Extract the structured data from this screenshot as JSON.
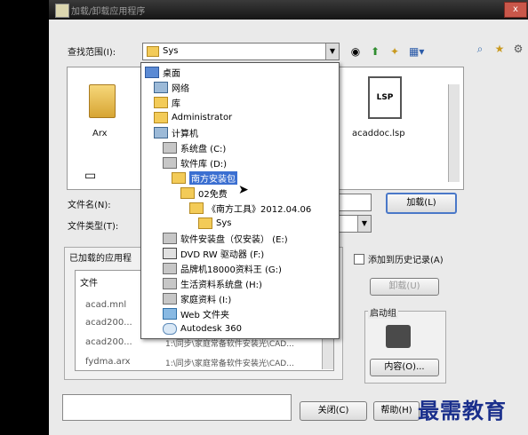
{
  "window": {
    "title": "加载/卸载应用程序",
    "close_label": "x"
  },
  "lookin": {
    "label": "查找范围(I):",
    "value": "Sys"
  },
  "files": [
    {
      "name": "Arx",
      "type": "folder"
    },
    {
      "name": "acaddoc.lsp",
      "type": "lsp",
      "badge": "LSP"
    }
  ],
  "form": {
    "filename_label": "文件名(N):",
    "filetype_label": "文件类型(T):",
    "load_button": "加载(L)"
  },
  "loaded": {
    "group_label": "已加载的应用程",
    "col_file": "文件",
    "rows": [
      "acad.mnl",
      "acad200...",
      "acad200...",
      "fydma.arx"
    ],
    "paths": [
      "",
      "",
      "1:\\同步\\家庭常备软件安装光\\CAD...",
      "1:\\同步\\家庭常备软件安装光\\CAD..."
    ]
  },
  "history": {
    "checkbox_label": "添加到历史记录(A)",
    "unload_button": "卸载(U)"
  },
  "startup": {
    "group_label": "启动组",
    "contents_button": "内容(O)..."
  },
  "footer": {
    "close_button": "关闭(C)",
    "help_button": "帮助(H)"
  },
  "dropdown": {
    "items": [
      {
        "label": "桌面",
        "icon": "desktop-icon"
      },
      {
        "label": "网络",
        "icon": "network-icon"
      },
      {
        "label": "库",
        "icon": "library-icon"
      },
      {
        "label": "Administrator",
        "icon": "user-folder-icon"
      },
      {
        "label": "计算机",
        "icon": "computer-icon"
      },
      {
        "label": "系统盘 (C:)",
        "icon": "drive-icon"
      },
      {
        "label": "软件库 (D:)",
        "icon": "drive-icon"
      },
      {
        "label": "南方安装包",
        "icon": "folder-icon"
      },
      {
        "label": "02免费",
        "icon": "folder-icon"
      },
      {
        "label": "《南方工具》2012.04.06",
        "icon": "folder-icon"
      },
      {
        "label": "Sys",
        "icon": "folder-icon"
      },
      {
        "label": "软件安装盘（仅安装） (E:)",
        "icon": "drive-icon"
      },
      {
        "label": "DVD RW 驱动器 (F:)",
        "icon": "dvd-icon"
      },
      {
        "label": "品牌机18000资料王 (G:)",
        "icon": "drive-icon"
      },
      {
        "label": "生活资料系统盘 (H:)",
        "icon": "drive-icon"
      },
      {
        "label": "家庭资料 (I:)",
        "icon": "drive-icon"
      },
      {
        "label": "Web 文件夹",
        "icon": "web-folder-icon"
      },
      {
        "label": "Autodesk 360",
        "icon": "cloud-icon"
      }
    ]
  },
  "watermark": {
    "text": "最需教育"
  }
}
